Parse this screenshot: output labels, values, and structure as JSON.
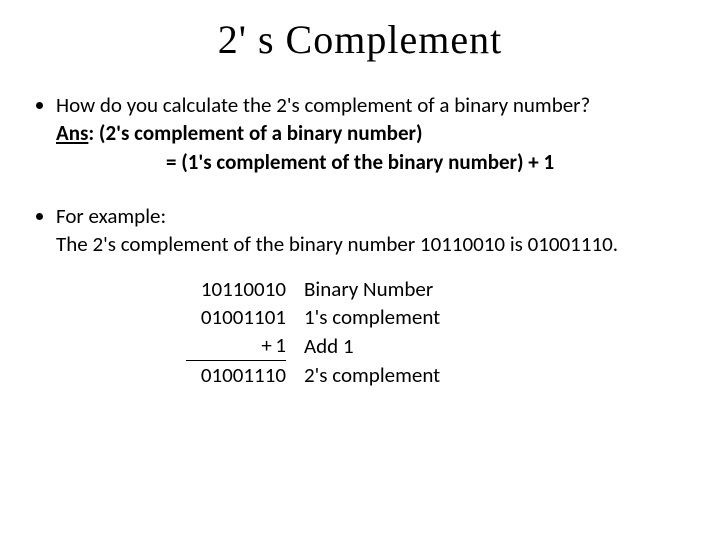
{
  "title": "2' s Complement",
  "bullet1": {
    "question": "How do you calculate the 2's complement of a binary number?",
    "ans_label": "Ans",
    "ans_colon": ":",
    "ans_line1": " (2's complement of a binary number)",
    "ans_line2": "= (1's complement of the binary number) + 1"
  },
  "bullet2": {
    "lead": "For example:",
    "sentence_pre": "The 2's complement of the binary number ",
    "number": "10110010",
    "sentence_mid": " is ",
    "result": "01001110",
    "sentence_end": "."
  },
  "calc": {
    "r1_num": "10110010",
    "r1_lbl": "Binary Number",
    "r2_num": "01001101",
    "r2_lbl": "1's complement",
    "r3_plus": "+",
    "r3_num": "1",
    "r3_lbl": "Add 1",
    "r4_num": "01001110",
    "r4_lbl": "2's complement"
  }
}
